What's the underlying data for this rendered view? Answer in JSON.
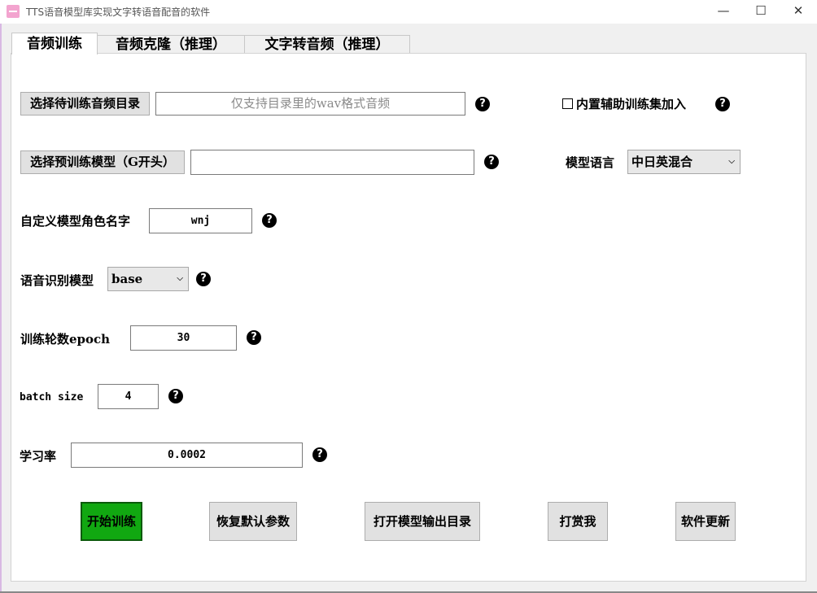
{
  "window": {
    "title": "TTS语音模型库实现文字转语音配音的软件",
    "minimize_glyph": "—",
    "maximize_glyph": "☐",
    "close_glyph": "✕"
  },
  "tabs": [
    {
      "label": "音频训练",
      "active": true
    },
    {
      "label": "音频克隆（推理）",
      "active": false
    },
    {
      "label": "文字转音频（推理）",
      "active": false
    }
  ],
  "train": {
    "select_audio_dir_button": "选择待训练音频目录",
    "audio_dir_placeholder": "仅支持目录里的wav格式音频",
    "builtin_aux_label": "内置辅助训练集加入",
    "builtin_aux_checked": false,
    "select_pretrained_button": "选择预训练模型（G开头）",
    "pretrained_value": "",
    "model_language_label": "模型语言",
    "model_language_value": "中日英混合",
    "role_name_label": "自定义模型角色名字",
    "role_name_value": "wnj",
    "asr_model_label": "语音识别模型",
    "asr_model_value": "base",
    "epoch_label": "训练轮数epoch",
    "epoch_value": "30",
    "batch_size_label": "batch size",
    "batch_size_value": "4",
    "lr_label": "学习率",
    "lr_value": "0.0002",
    "help_glyph": "?"
  },
  "actions": {
    "start": "开始训练",
    "reset": "恢复默认参数",
    "open_output": "打开模型输出目录",
    "donate": "打赏我",
    "update": "软件更新"
  },
  "colors": {
    "start_button": "#11a811",
    "button_bg": "#e1e1e1",
    "panel_bg": "#ffffff",
    "window_bg": "#f0f0f0"
  }
}
